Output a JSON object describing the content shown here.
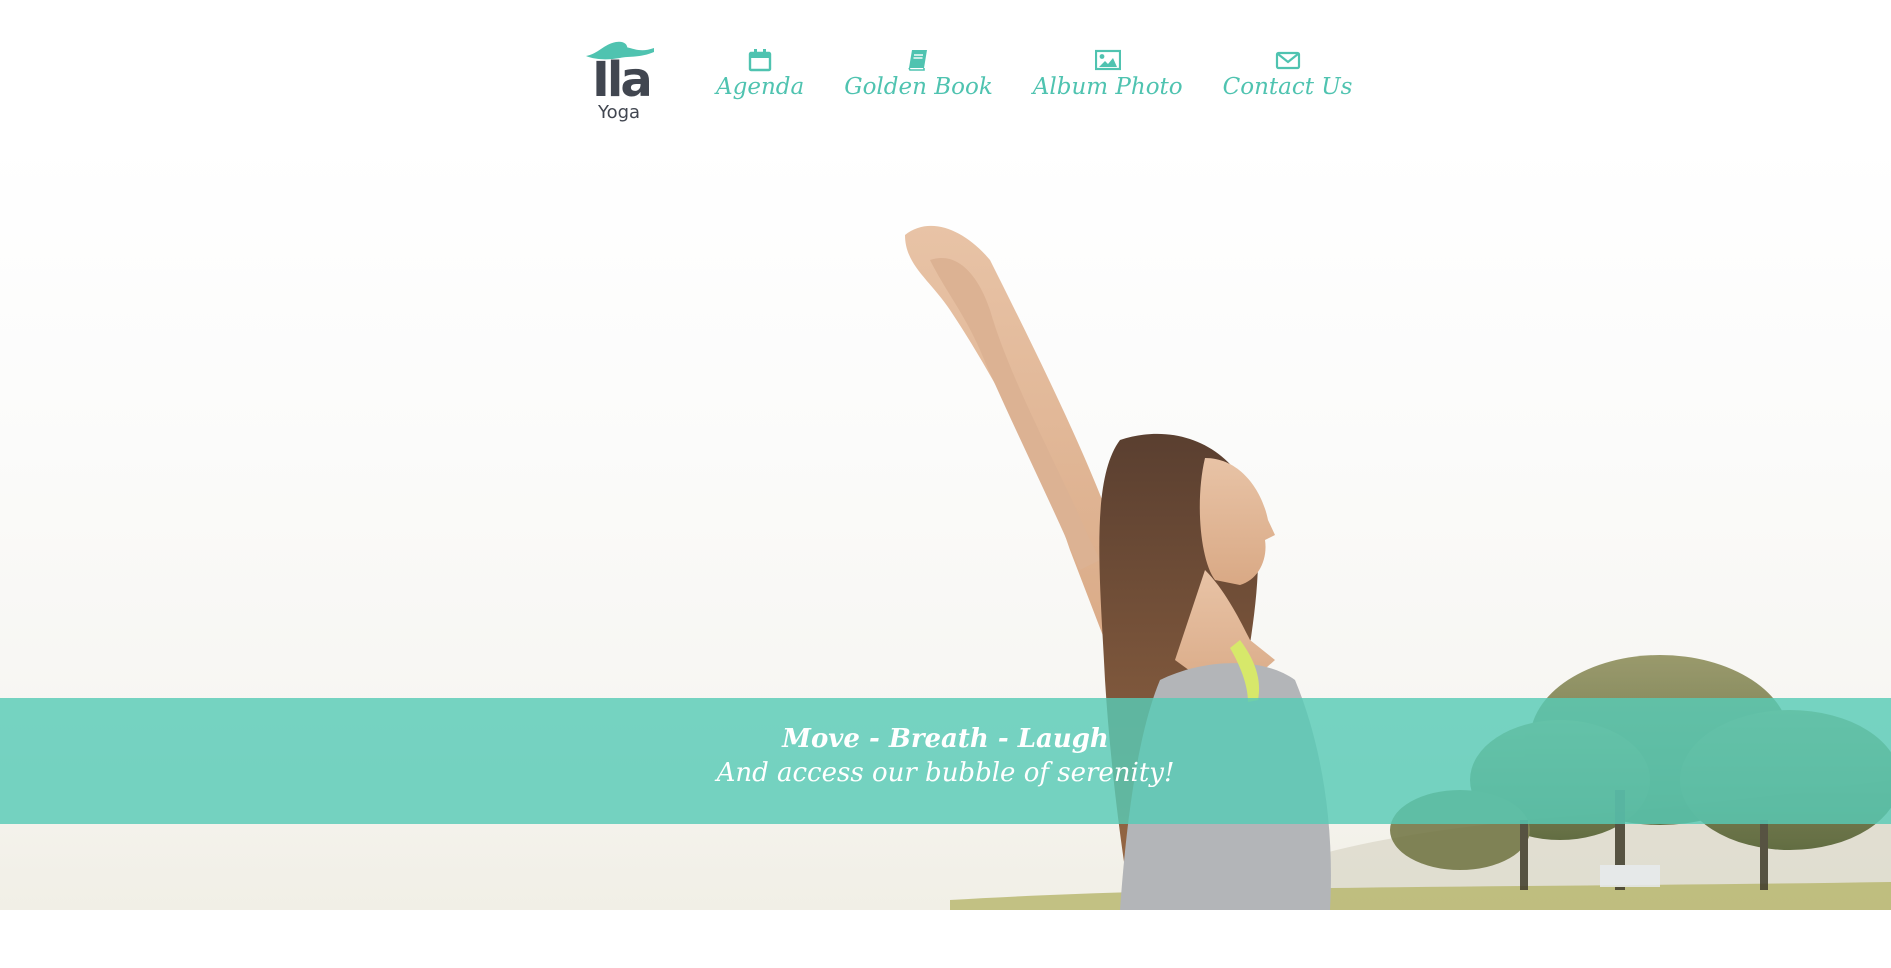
{
  "brand": {
    "name": "Ila",
    "subtitle": "Yoga",
    "colors": {
      "accent": "#4fc3b0",
      "logo_text": "#414650",
      "banner": "#58cab6"
    }
  },
  "nav": {
    "items": [
      {
        "label": "Agenda",
        "icon": "calendar-icon"
      },
      {
        "label": "Golden Book",
        "icon": "book-icon"
      },
      {
        "label": "Album Photo",
        "icon": "image-icon"
      },
      {
        "label": "Contact Us",
        "icon": "envelope-icon"
      }
    ]
  },
  "hero": {
    "tagline": "Move - Breath - Laugh",
    "subtagline": "And access our bubble of serenity!"
  }
}
